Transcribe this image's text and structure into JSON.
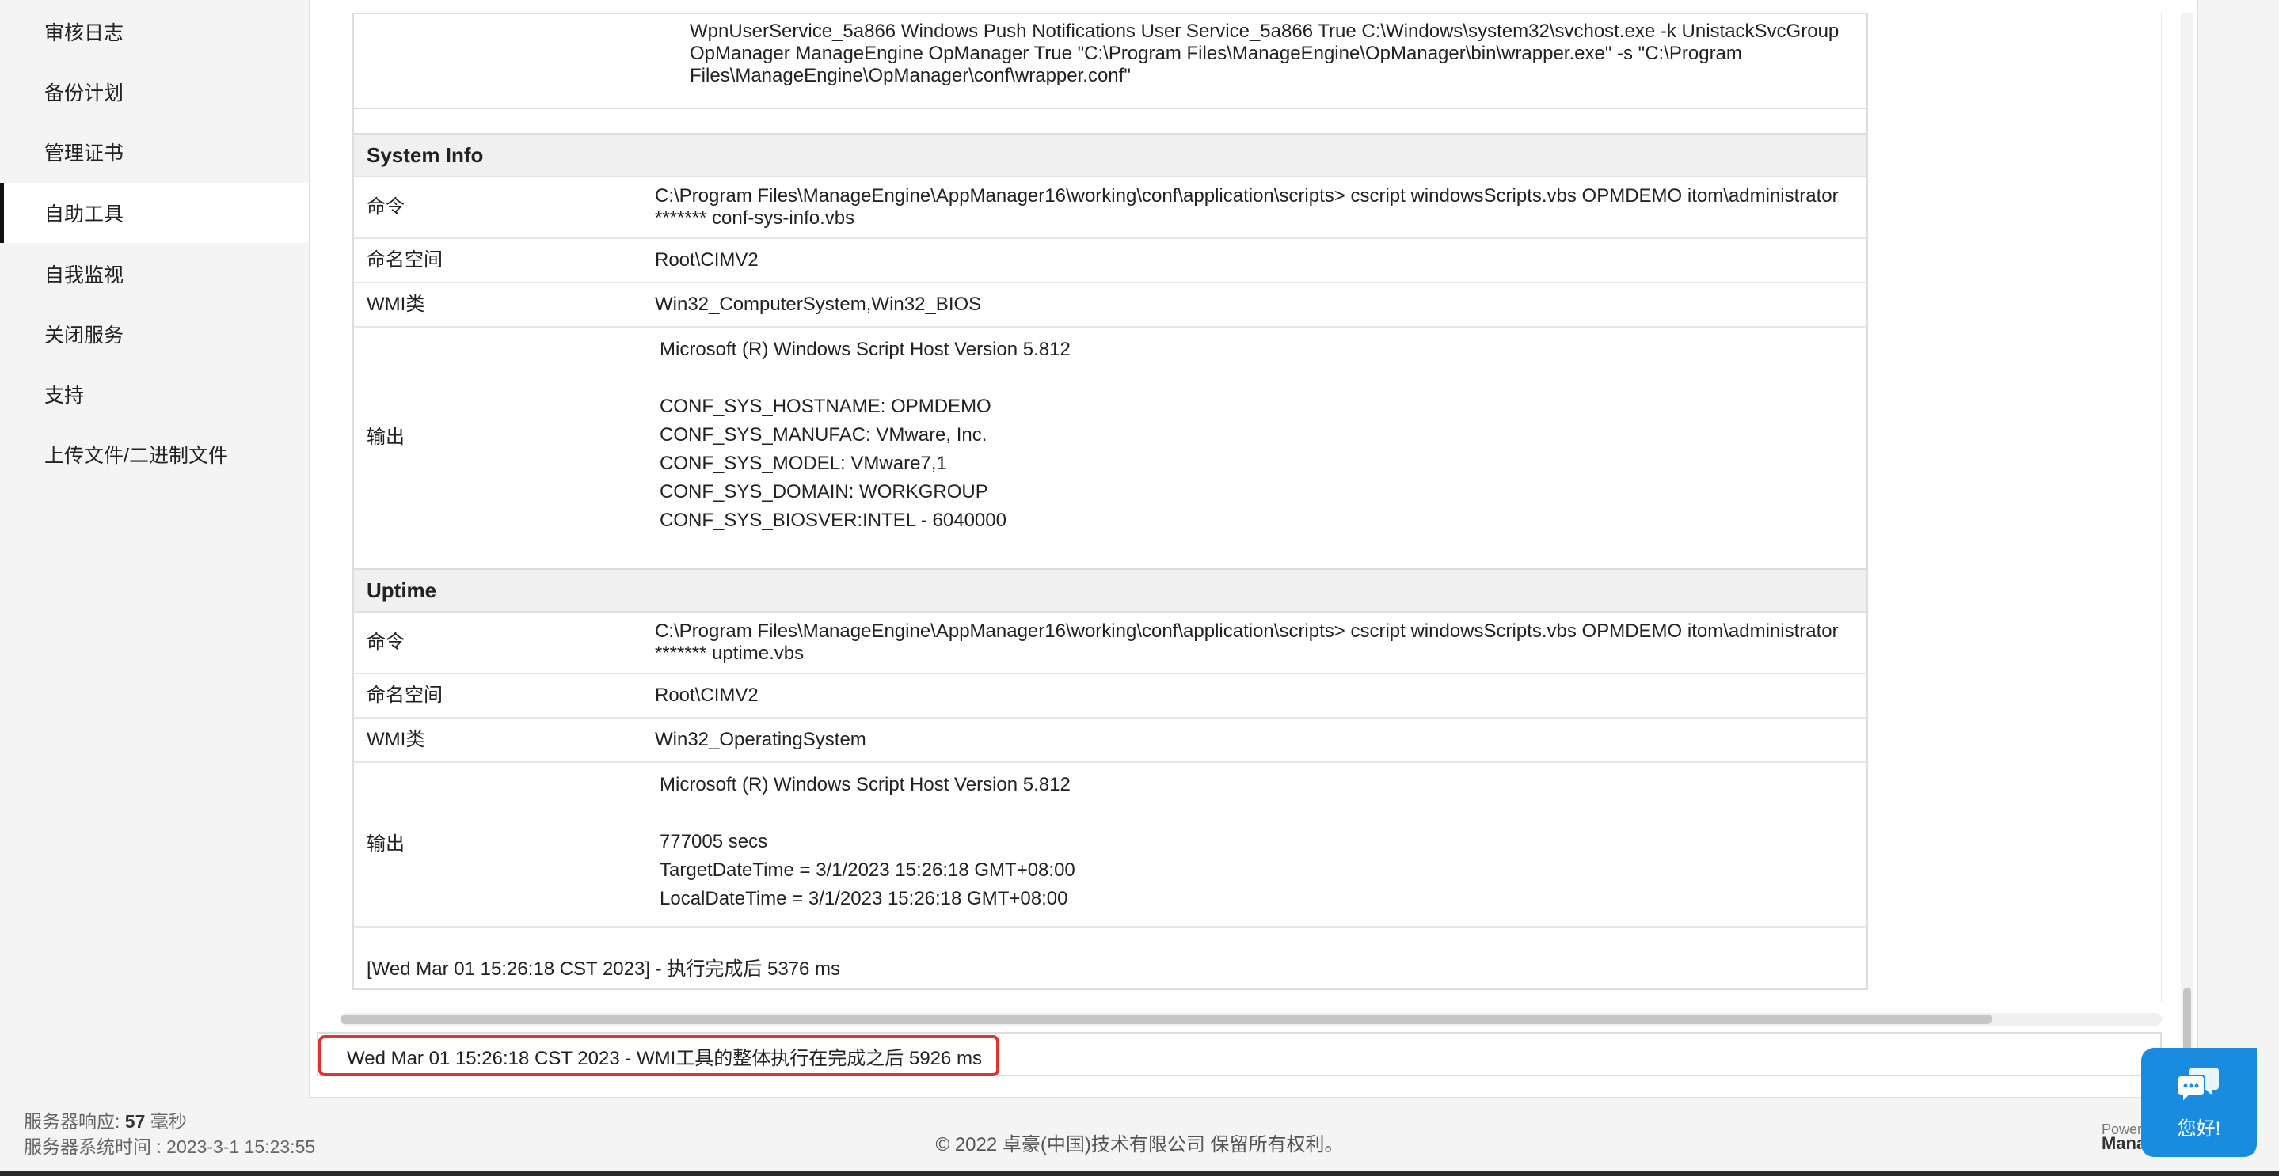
{
  "sidebar": {
    "items": [
      {
        "label": "审核日志"
      },
      {
        "label": "备份计划"
      },
      {
        "label": "管理证书"
      },
      {
        "label": "自助工具"
      },
      {
        "label": "自我监视"
      },
      {
        "label": "关闭服务"
      },
      {
        "label": "支持"
      },
      {
        "label": "上传文件/二进制文件"
      }
    ],
    "active_index": 3
  },
  "server_info": {
    "response_label": "服务器响应:",
    "response_value": "57",
    "response_unit": "毫秒",
    "time_label": "服务器系统时间 :",
    "time_value": "2023-3-1 15:23:55"
  },
  "services": {
    "line1": "WpnUserService_5a866 Windows Push Notifications User Service_5a866 True C:\\Windows\\system32\\svchost.exe -k UnistackSvcGroup",
    "line2": "OpManager ManageEngine OpManager True \"C:\\Program Files\\ManageEngine\\OpManager\\bin\\wrapper.exe\" -s \"C:\\Program Files\\ManageEngine\\OpManager\\conf\\wrapper.conf\""
  },
  "sections": [
    {
      "title": "System Info",
      "command_label": "命令",
      "command": "C:\\Program Files\\ManageEngine\\AppManager16\\working\\conf\\application\\scripts> cscript windowsScripts.vbs OPMDEMO itom\\administrator ******* conf-sys-info.vbs",
      "namespace_label": "命名空间",
      "namespace": "Root\\CIMV2",
      "wmi_label": "WMI类",
      "wmi": "Win32_ComputerSystem,Win32_BIOS",
      "output_label": "输出",
      "output": "Microsoft (R) Windows Script Host Version 5.812\n\nCONF_SYS_HOSTNAME: OPMDEMO\nCONF_SYS_MANUFAC: VMware, Inc.\nCONF_SYS_MODEL: VMware7,1\nCONF_SYS_DOMAIN: WORKGROUP\nCONF_SYS_BIOSVER:INTEL - 6040000"
    },
    {
      "title": "Uptime",
      "command_label": "命令",
      "command": "C:\\Program Files\\ManageEngine\\AppManager16\\working\\conf\\application\\scripts> cscript windowsScripts.vbs OPMDEMO itom\\administrator ******* uptime.vbs",
      "namespace_label": "命名空间",
      "namespace": "Root\\CIMV2",
      "wmi_label": "WMI类",
      "wmi": "Win32_OperatingSystem",
      "output_label": "输出",
      "output": "Microsoft (R) Windows Script Host Version 5.812\n\n777005 secs\nTargetDateTime = 3/1/2023 15:26:18 GMT+08:00\nLocalDateTime = 3/1/2023 15:26:18 GMT+08:00"
    }
  ],
  "execution_done": "[Wed Mar 01 15:26:18 CST 2023] - 执行完成后 5376 ms",
  "status_message": "Wed Mar 01 15:26:18 CST 2023 - WMI工具的整体执行在完成之后 5926 ms",
  "footer": "© 2022 卓豪(中国)技术有限公司   保留所有权利。",
  "chat": {
    "label": "您好!",
    "icon": "chat-bubbles-icon"
  },
  "powered": {
    "line1": "Power",
    "line2": "Mana"
  },
  "colors": {
    "highlight": "#e53030",
    "chat": "#1a8ce0",
    "active_border": "#111111"
  }
}
